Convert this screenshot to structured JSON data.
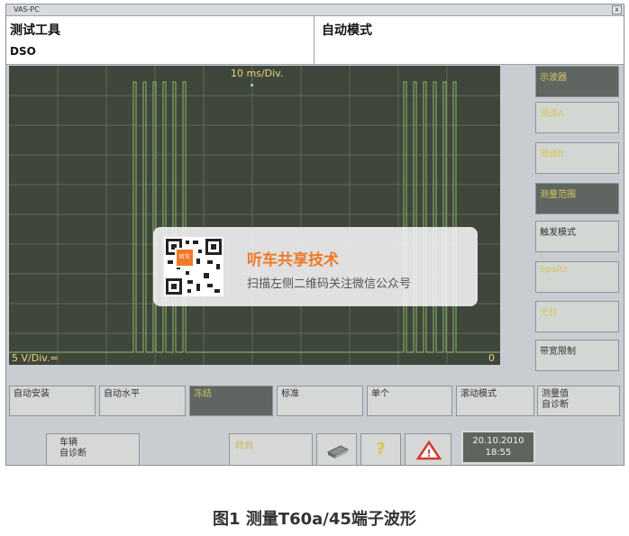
{
  "window": {
    "title": "VAS-PC",
    "close_label": "x"
  },
  "header": {
    "title": "测试工具",
    "subtitle": "DSO",
    "mode": "自动模式"
  },
  "scope": {
    "timebase": "10 ms/Div.",
    "voltage": "5 V/Div.=",
    "zero": "0"
  },
  "right_buttons": [
    {
      "label": "示波器"
    },
    {
      "label": "通道A"
    },
    {
      "label": "通道B"
    },
    {
      "label": "测量范围"
    },
    {
      "label": "触发模式"
    },
    {
      "label": "Spaltz"
    },
    {
      "label": "光标"
    },
    {
      "label": "带宽限制"
    }
  ],
  "bottom_buttons": [
    {
      "label": "自动安装"
    },
    {
      "label": "自动水平"
    },
    {
      "label": "冻结"
    },
    {
      "label": "标准"
    },
    {
      "label": "单个"
    },
    {
      "label": "滚动模式"
    },
    {
      "label": "测量值\n自诊断"
    }
  ],
  "status_bar": {
    "back_label": "车辆\n自诊断",
    "goto_label": "转到",
    "help_symbol": "?",
    "warn_symbol": "!",
    "date": "20.10.2010",
    "time": "18:55"
  },
  "overlay": {
    "badge": "听车",
    "title": "听车共享技术",
    "subtitle": "扫描左侧二维码关注微信公众号"
  },
  "caption": "图1 测量T60a/45端子波形"
}
